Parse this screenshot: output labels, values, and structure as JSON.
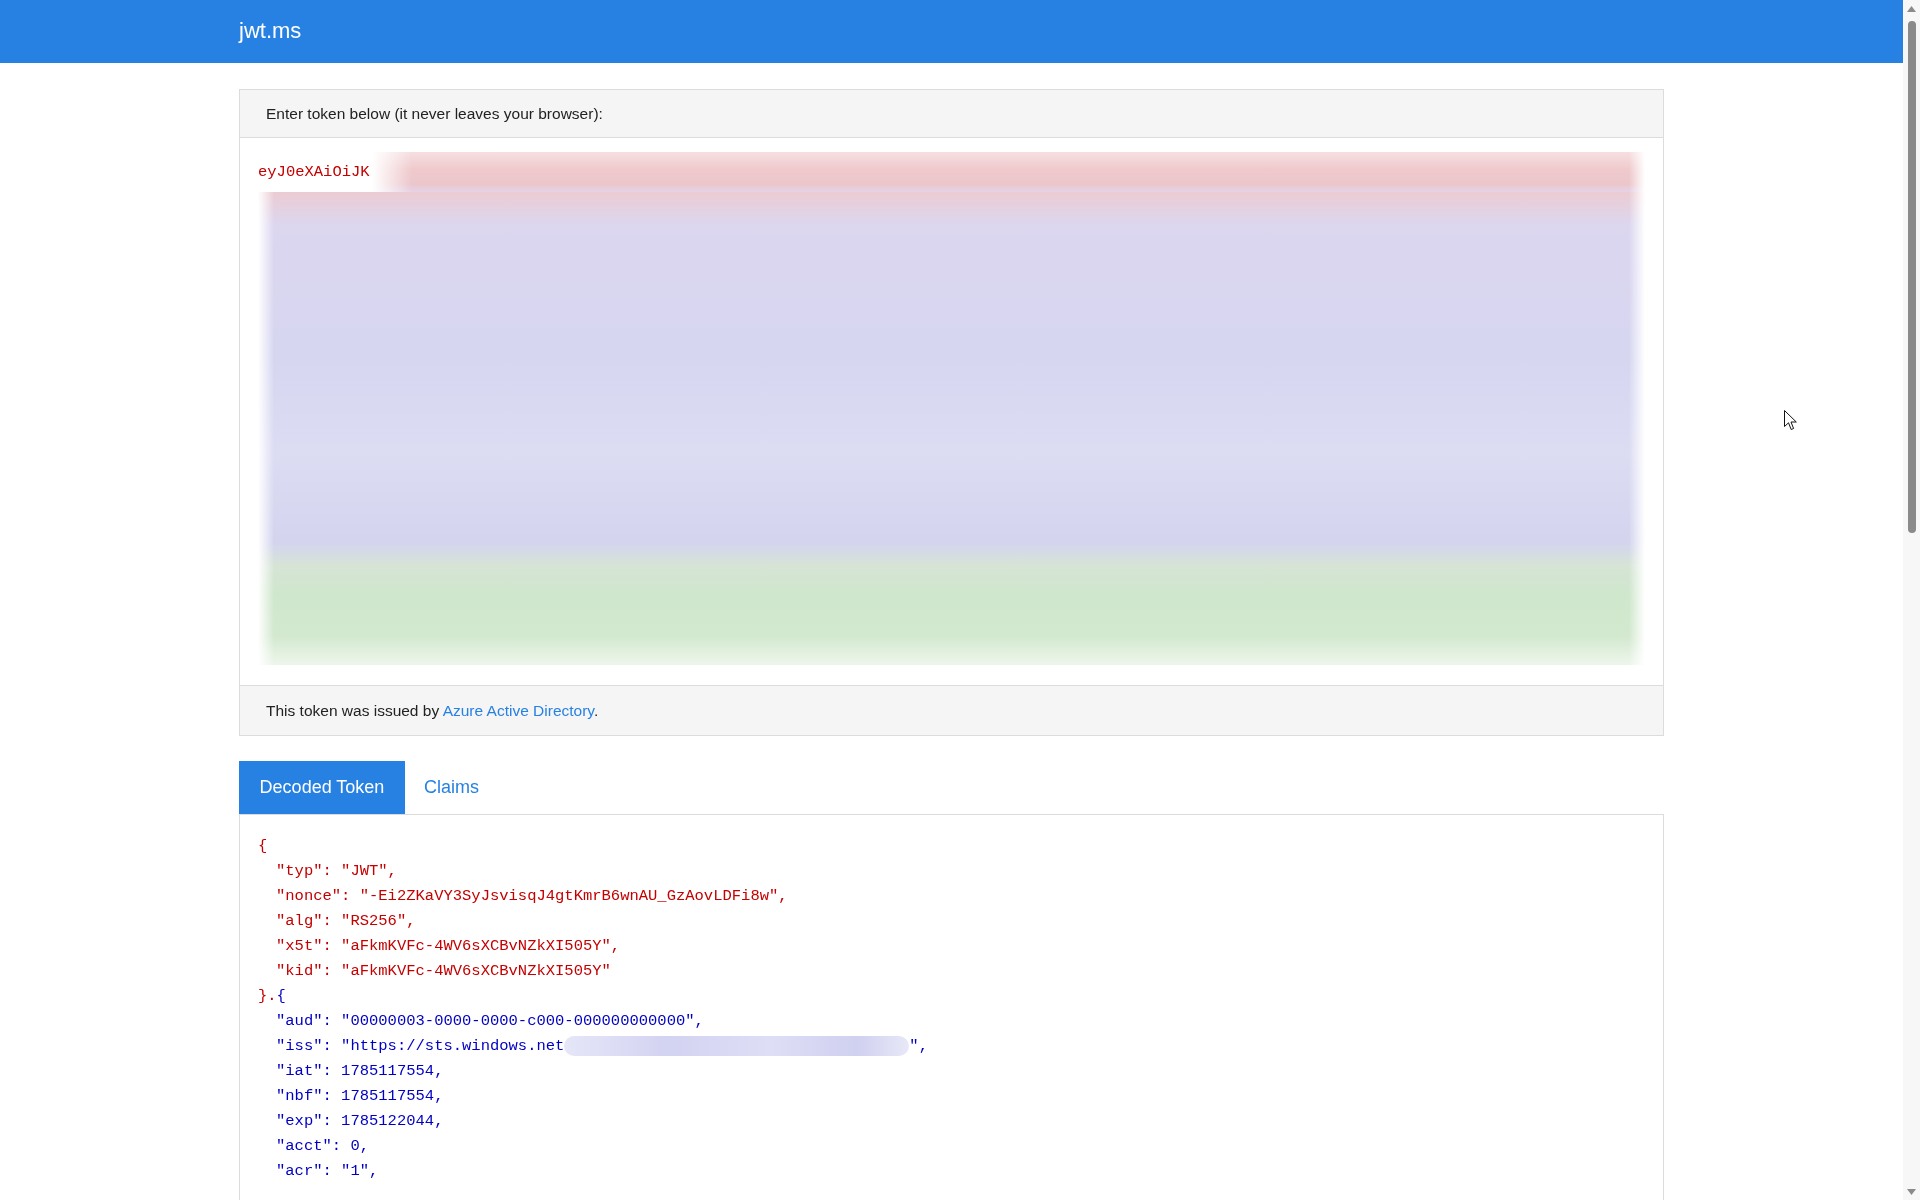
{
  "header": {
    "title": "jwt.ms"
  },
  "token_panel": {
    "heading": "Enter token below (it never leaves your browser):",
    "token_visible": "eyJ0eXAiOiJK",
    "token_redacted": true,
    "footer": {
      "text": "This token was issued by ",
      "link": "Azure Active Directory",
      "after": "."
    }
  },
  "tabs": [
    {
      "label": "Decoded Token",
      "selected": true
    },
    {
      "label": "Claims",
      "selected": false
    }
  ],
  "decoded_token": {
    "sections": [
      {
        "kind": "header",
        "open": "{",
        "lines": [
          {
            "text": "\"typ\": \"JWT\","
          },
          {
            "text": "\"nonce\": \"-Ei2ZKaVY3SyJsvisqJ4gtKmrB6wnAU_GzAovLDFi8w\","
          },
          {
            "text": "\"alg\": \"RS256\","
          },
          {
            "text": "\"x5t\": \"aFkmKVFc-4WV6sXCBvNZkXI505Y\","
          },
          {
            "text": "\"kid\": \"aFkmKVFc-4WV6sXCBvNZkXI505Y\""
          }
        ],
        "close": "}."
      },
      {
        "kind": "payload",
        "open": "{",
        "lines": [
          {
            "text": "\"aud\": \"00000003-0000-0000-c000-000000000000\","
          },
          {
            "text": "\"iss\": \"https://sts.windows.net",
            "redacted": true,
            "after": "\","
          },
          {
            "text": "\"iat\": 1785117554,"
          },
          {
            "text": "\"nbf\": 1785117554,"
          },
          {
            "text": "\"exp\": 1785122044,"
          },
          {
            "text": "\"acct\": 0,"
          },
          {
            "text": "\"acr\": \"1\","
          }
        ]
      }
    ]
  }
}
